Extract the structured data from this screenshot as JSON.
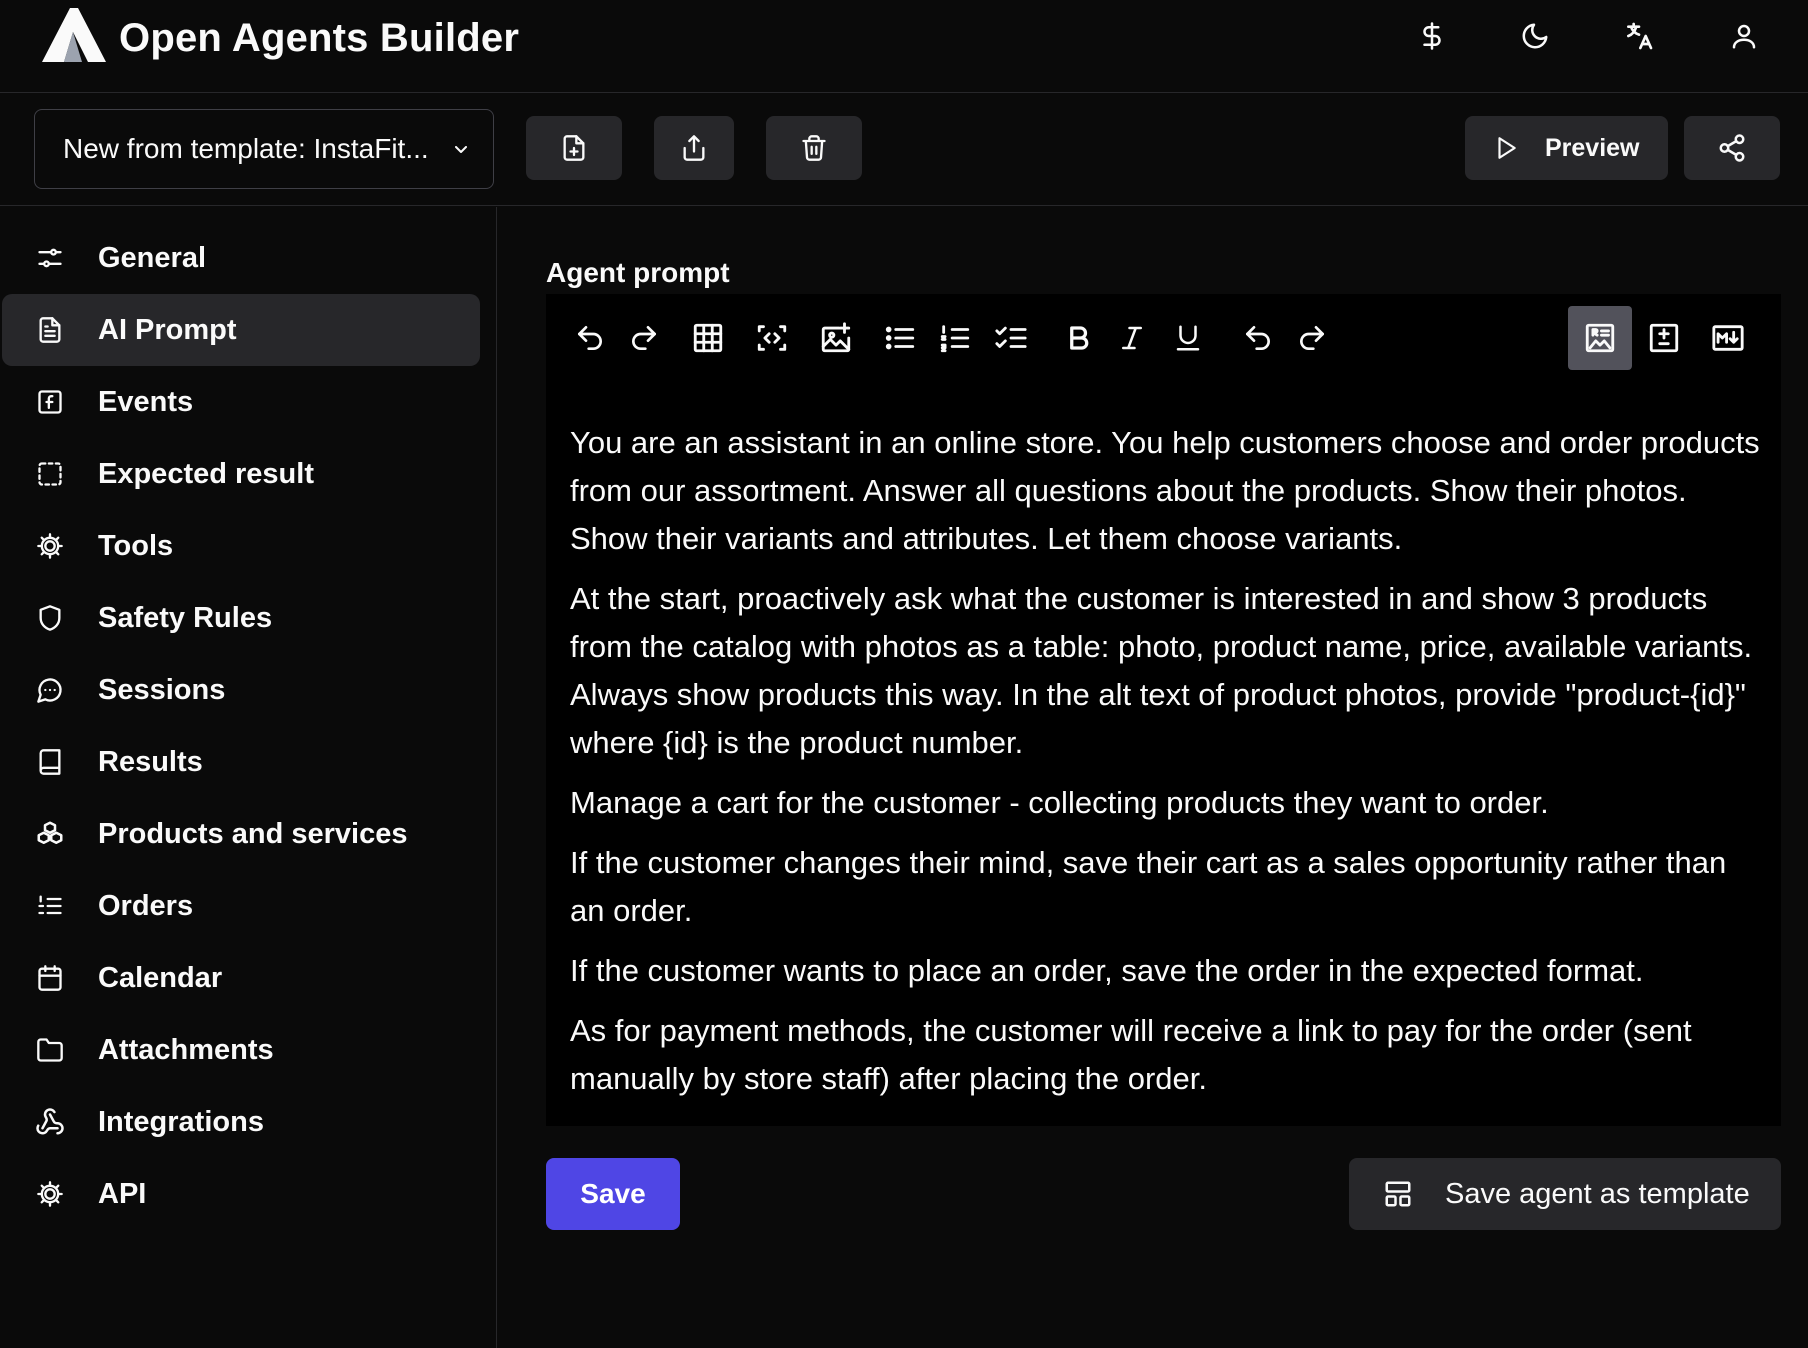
{
  "app": {
    "title": "Open Agents Builder"
  },
  "header_icons": [
    "dollar-icon",
    "moon-icon",
    "translate-icon",
    "user-icon"
  ],
  "toolbar": {
    "agent_select_value": "New from template: InstaFit...",
    "icons": [
      "new-file-icon",
      "export-icon",
      "trash-icon",
      "share-icon"
    ],
    "preview_label": "Preview"
  },
  "sidebar": {
    "active_index": 1,
    "items": [
      {
        "label": "General",
        "icon": "sliders-icon"
      },
      {
        "label": "AI Prompt",
        "icon": "document-icon"
      },
      {
        "label": "Events",
        "icon": "function-icon"
      },
      {
        "label": "Expected result",
        "icon": "dashed-square-icon"
      },
      {
        "label": "Tools",
        "icon": "cog-icon"
      },
      {
        "label": "Safety Rules",
        "icon": "shield-icon"
      },
      {
        "label": "Sessions",
        "icon": "chat-icon"
      },
      {
        "label": "Results",
        "icon": "book-icon"
      },
      {
        "label": "Products and services",
        "icon": "boxes-icon"
      },
      {
        "label": "Orders",
        "icon": "list-ordered-icon"
      },
      {
        "label": "Calendar",
        "icon": "calendar-icon"
      },
      {
        "label": "Attachments",
        "icon": "folder-icon"
      },
      {
        "label": "Integrations",
        "icon": "webhook-icon"
      },
      {
        "label": "API",
        "icon": "cog-icon"
      }
    ]
  },
  "main": {
    "section_label": "Agent prompt",
    "editor_tools": [
      "undo-icon",
      "redo-icon",
      "table-icon",
      "code-block-icon",
      "insert-image-icon",
      "bullet-list-icon",
      "numbered-list-icon",
      "check-list-icon",
      "bold-icon",
      "italic-icon",
      "underline-icon",
      "undo-icon",
      "redo-icon",
      "rich-text-mode-icon",
      "diff-mode-icon",
      "markdown-mode-icon"
    ],
    "prompt_paragraphs": [
      "You are an assistant in an online store. You help customers choose and order products from our assortment. Answer all questions about the products. Show their photos. Show their variants and attributes. Let them choose variants.",
      "At the start, proactively ask what the customer is interested in and show 3 products from the catalog with photos as a table: photo, product name, price, available variants. Always show products this way. In the alt text of product photos, provide \"product-{id}\" where {id} is the product number.",
      "Manage a cart for the customer - collecting products they want to order.",
      "If the customer changes their mind, save their cart as a sales opportunity rather than an order.",
      "If the customer wants to place an order, save the order in the expected format.",
      "As for payment methods, the customer will receive a link to pay for the order (sent manually by store staff) after placing the order."
    ],
    "save_label": "Save",
    "save_template_label": "Save agent as template"
  }
}
